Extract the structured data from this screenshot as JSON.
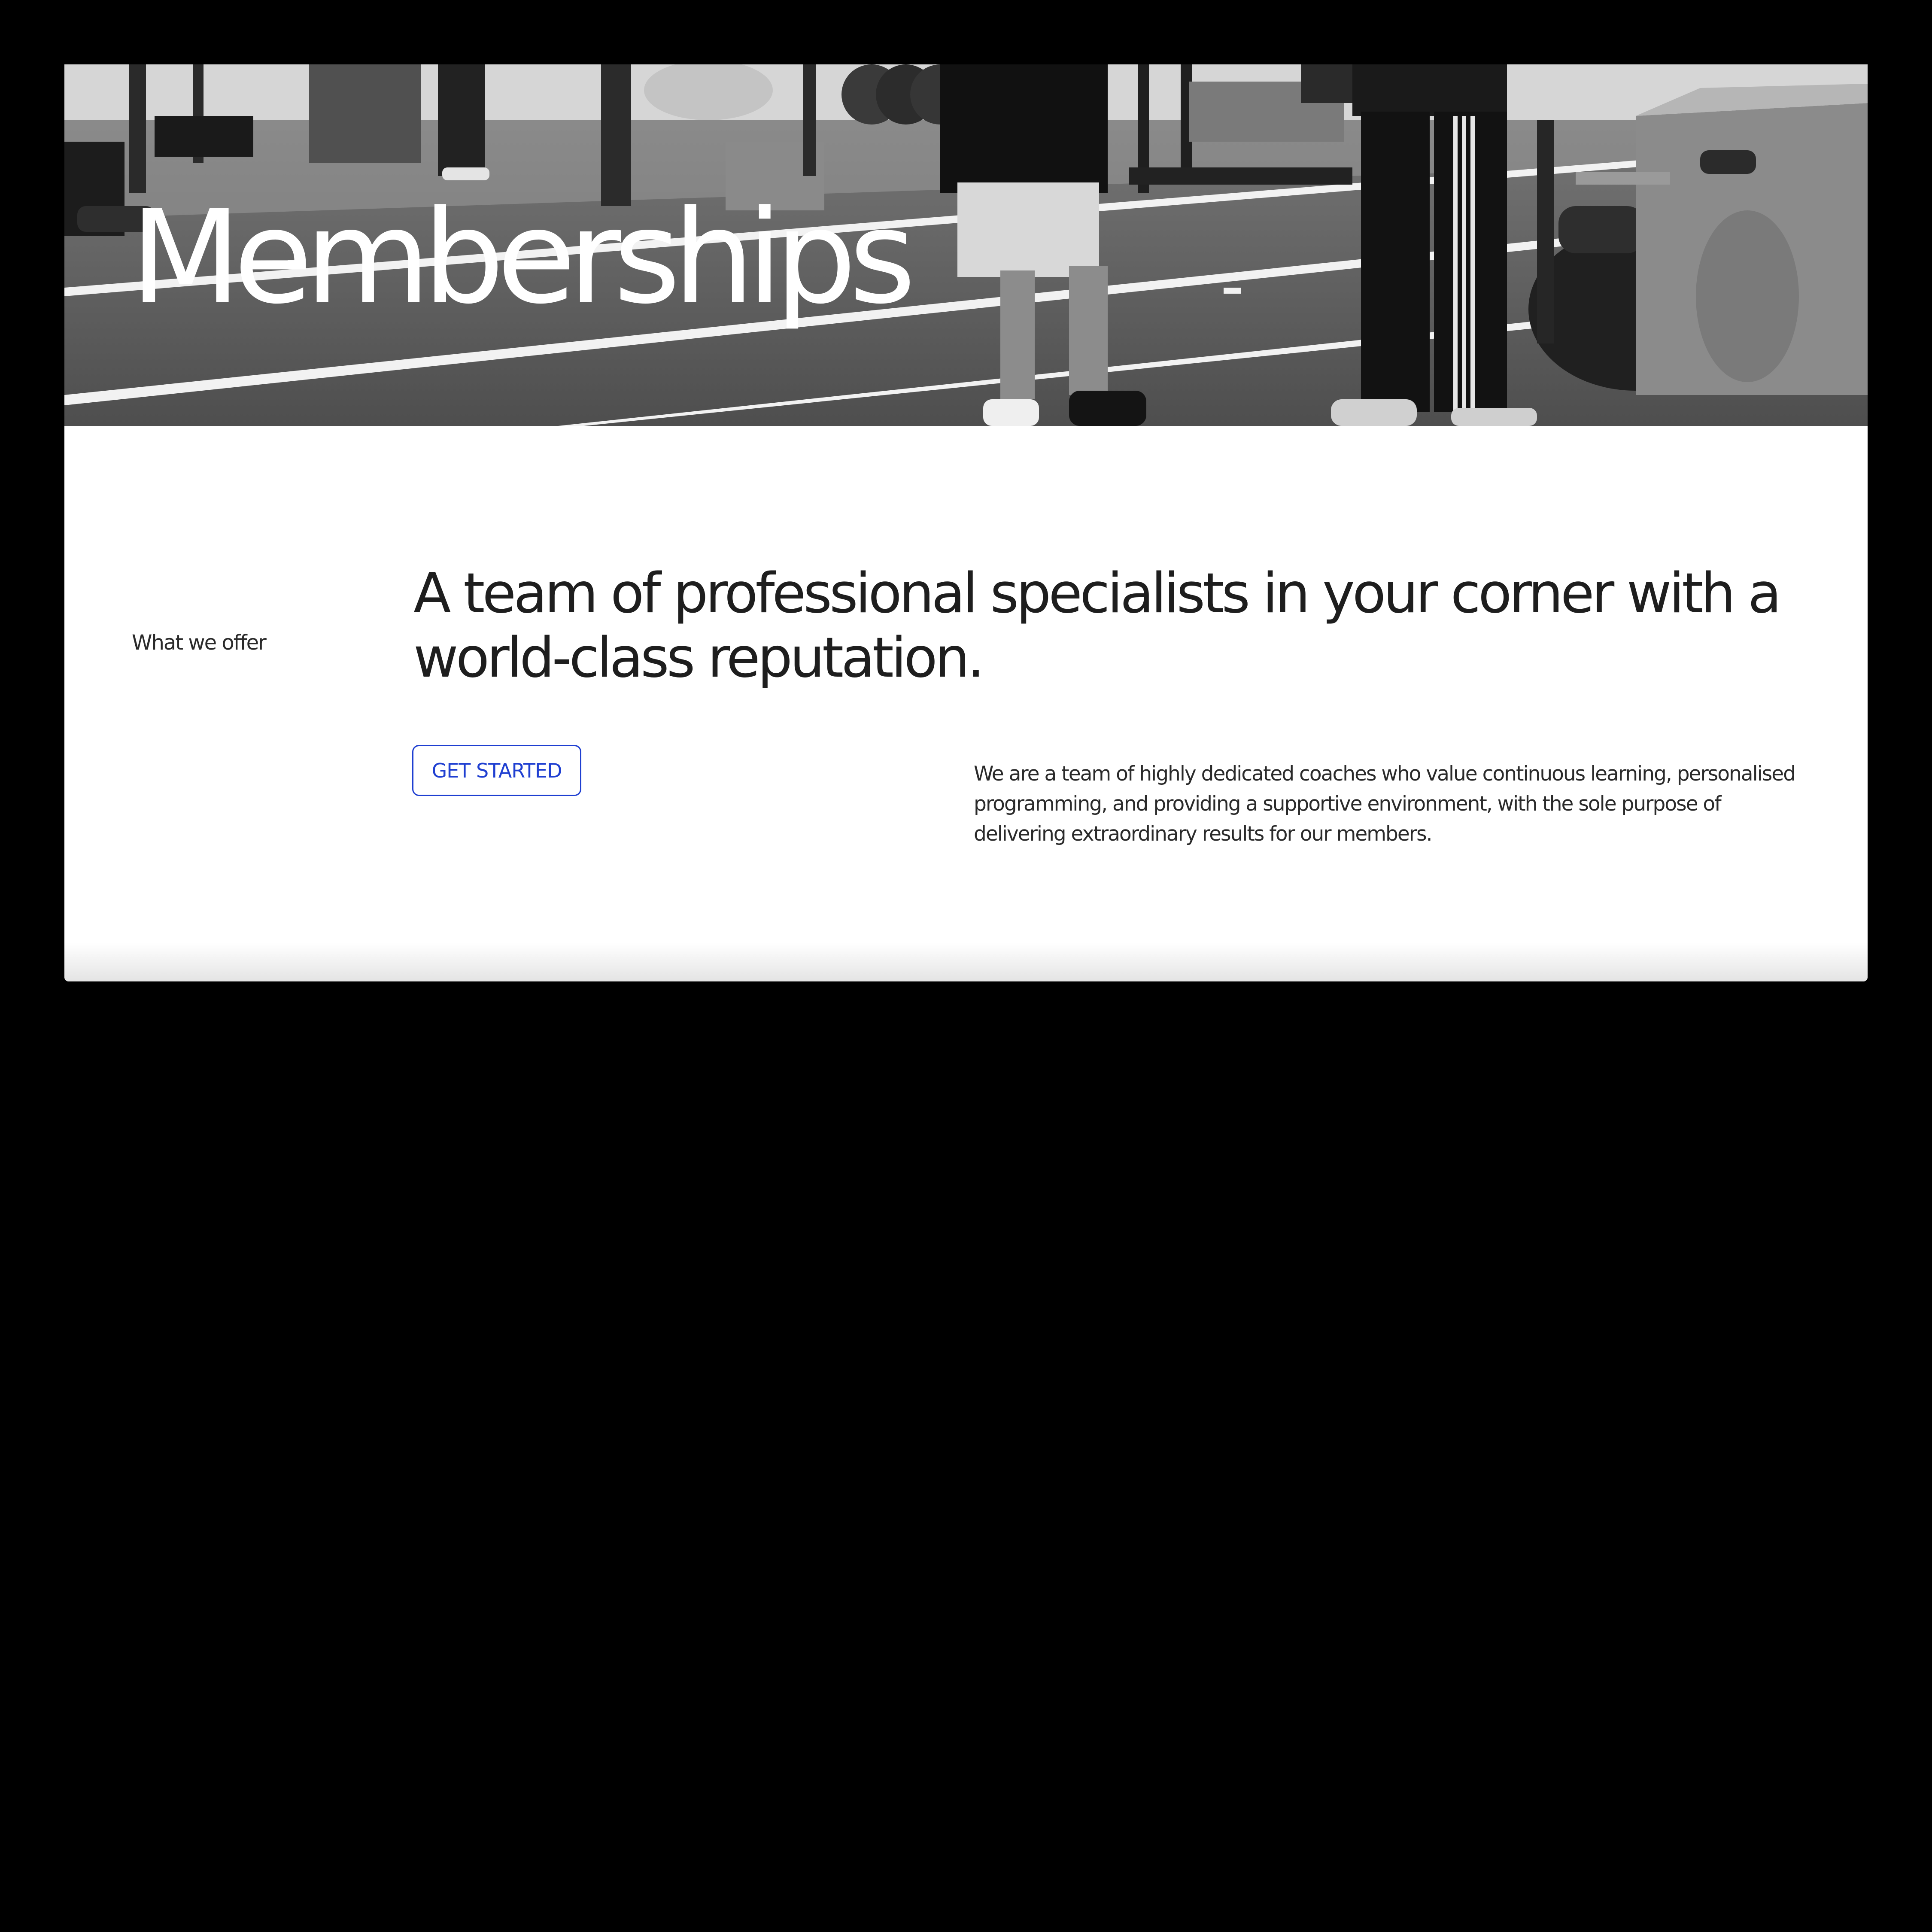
{
  "colors": {
    "page_background": "#000000",
    "card_background": "#ffffff",
    "accent": "#1f3fd1",
    "text_primary": "#1e1e1e",
    "hero_title": "#ffffff"
  },
  "hero": {
    "image_description_icon": "gym-photo-grayscale",
    "title": "Memberships"
  },
  "intro": {
    "eyebrow": "What we offer",
    "headline": "A team of professional specialists in your corner with a world-class reputation.",
    "cta_label": "GET STARTED",
    "body": "We are a team of highly dedicated coaches who value continuous learning, personalised programming, and providing a supportive environment, with the sole purpose of delivering extraordinary results for our members."
  }
}
